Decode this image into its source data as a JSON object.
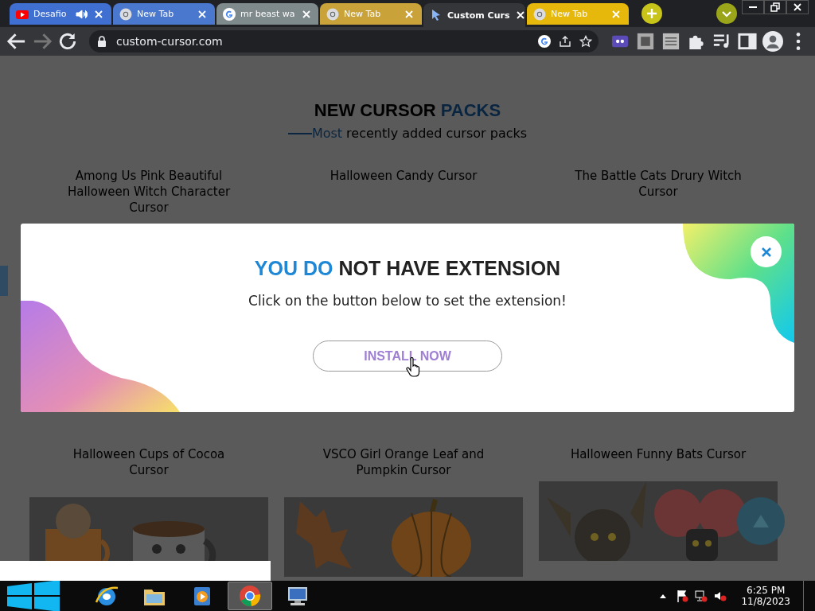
{
  "tabs": [
    {
      "title": "Desafio",
      "kind": "youtube",
      "audio": true,
      "selected": false,
      "color": "#3f6fd0"
    },
    {
      "title": "New Tab",
      "kind": "chrome",
      "audio": false,
      "selected": false,
      "color": "#4a78cf"
    },
    {
      "title": "mr beast wa",
      "kind": "google",
      "audio": false,
      "selected": false,
      "color": "#7f8a8c"
    },
    {
      "title": "New Tab",
      "kind": "chrome",
      "audio": false,
      "selected": false,
      "color": "#c9a23a"
    },
    {
      "title": "Custom Curs",
      "kind": "cursor",
      "audio": false,
      "selected": true,
      "color": "#35363a"
    },
    {
      "title": "New Tab",
      "kind": "chrome",
      "audio": false,
      "selected": false,
      "color": "#e6b80b"
    }
  ],
  "address_bar": {
    "url": "custom-cursor.com"
  },
  "navigation": {
    "forward_disabled": true
  },
  "page": {
    "heading": {
      "first": "NEW CURSOR",
      "second": "PACKS"
    },
    "subheading": {
      "first": "Most",
      "rest": "recently added cursor packs"
    },
    "packs": [
      {
        "title": "Among Us Pink Beautiful Halloween Witch Character Cursor",
        "picture": false
      },
      {
        "title": "Halloween Candy Cursor",
        "picture": false
      },
      {
        "title": "The Battle Cats Drury Witch Cursor",
        "picture": false
      },
      {
        "title": "Halloween Cups of Cocoa Cursor",
        "picture": true
      },
      {
        "title": "VSCO Girl Orange Leaf and Pumpkin Cursor",
        "picture": true
      },
      {
        "title": "Halloween Funny Bats Cursor",
        "picture": true
      }
    ]
  },
  "modal": {
    "title": {
      "highlight": "YOU DO",
      "rest": "NOT HAVE EXTENSION"
    },
    "message": "Click on the button below to set the extension!",
    "button": "INSTALL NOW"
  },
  "taskbar": {
    "apps": [
      {
        "kind": "ie",
        "selected": false
      },
      {
        "kind": "explorer",
        "selected": false
      },
      {
        "kind": "media",
        "selected": false
      },
      {
        "kind": "chrome",
        "selected": true
      },
      {
        "kind": "remote",
        "selected": false
      }
    ],
    "time": "6:25 PM",
    "date": "11/8/2023"
  }
}
